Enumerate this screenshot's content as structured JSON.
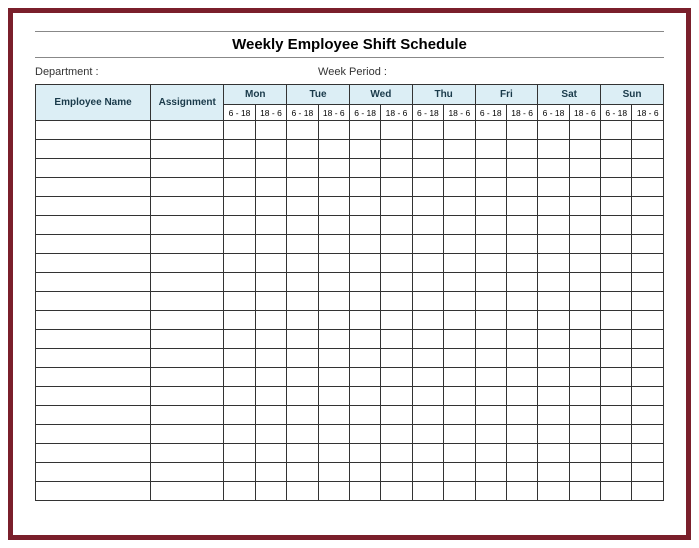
{
  "title": "Weekly Employee Shift Schedule",
  "meta": {
    "department_label": "Department :",
    "week_period_label": "Week  Period :"
  },
  "columns": {
    "employee_name": "Employee Name",
    "assignment": "Assignment"
  },
  "days": [
    "Mon",
    "Tue",
    "Wed",
    "Thu",
    "Fri",
    "Sat",
    "Sun"
  ],
  "shifts": [
    "6 - 18",
    "18 - 6"
  ],
  "row_count": 20
}
